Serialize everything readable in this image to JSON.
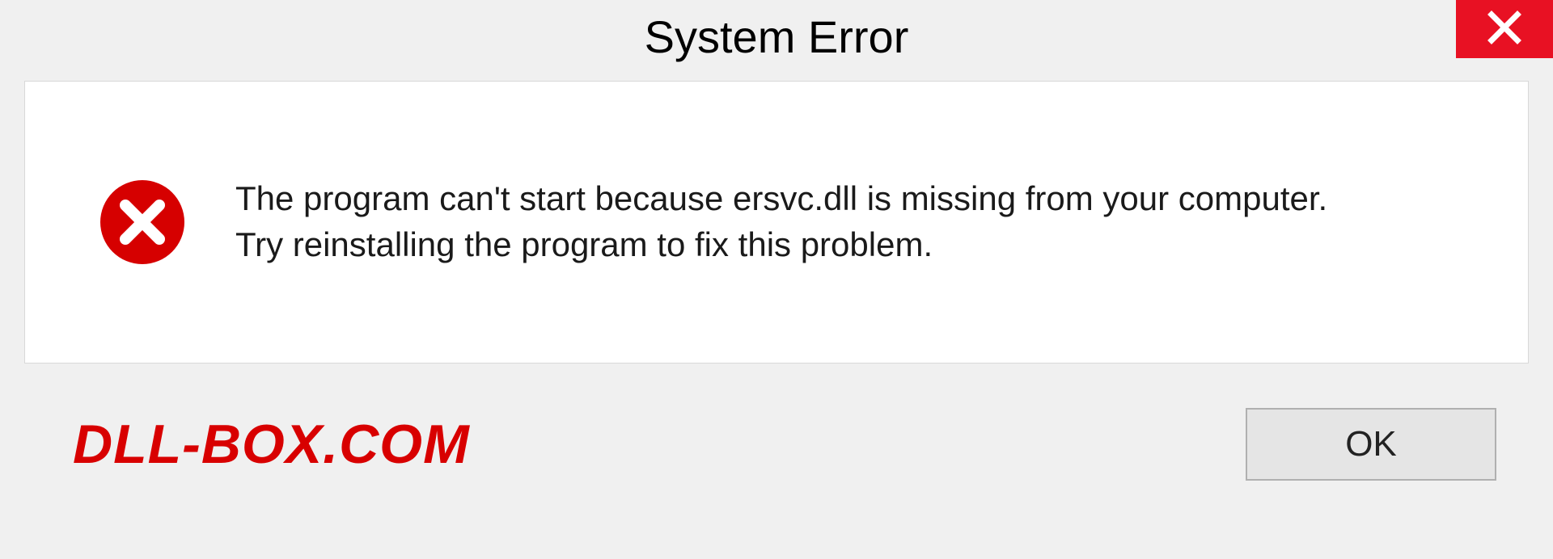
{
  "dialog": {
    "title": "System Error",
    "message_line1": "The program can't start because ersvc.dll is missing from your computer.",
    "message_line2": "Try reinstalling the program to fix this problem.",
    "ok_label": "OK"
  },
  "watermark": "DLL-BOX.COM"
}
